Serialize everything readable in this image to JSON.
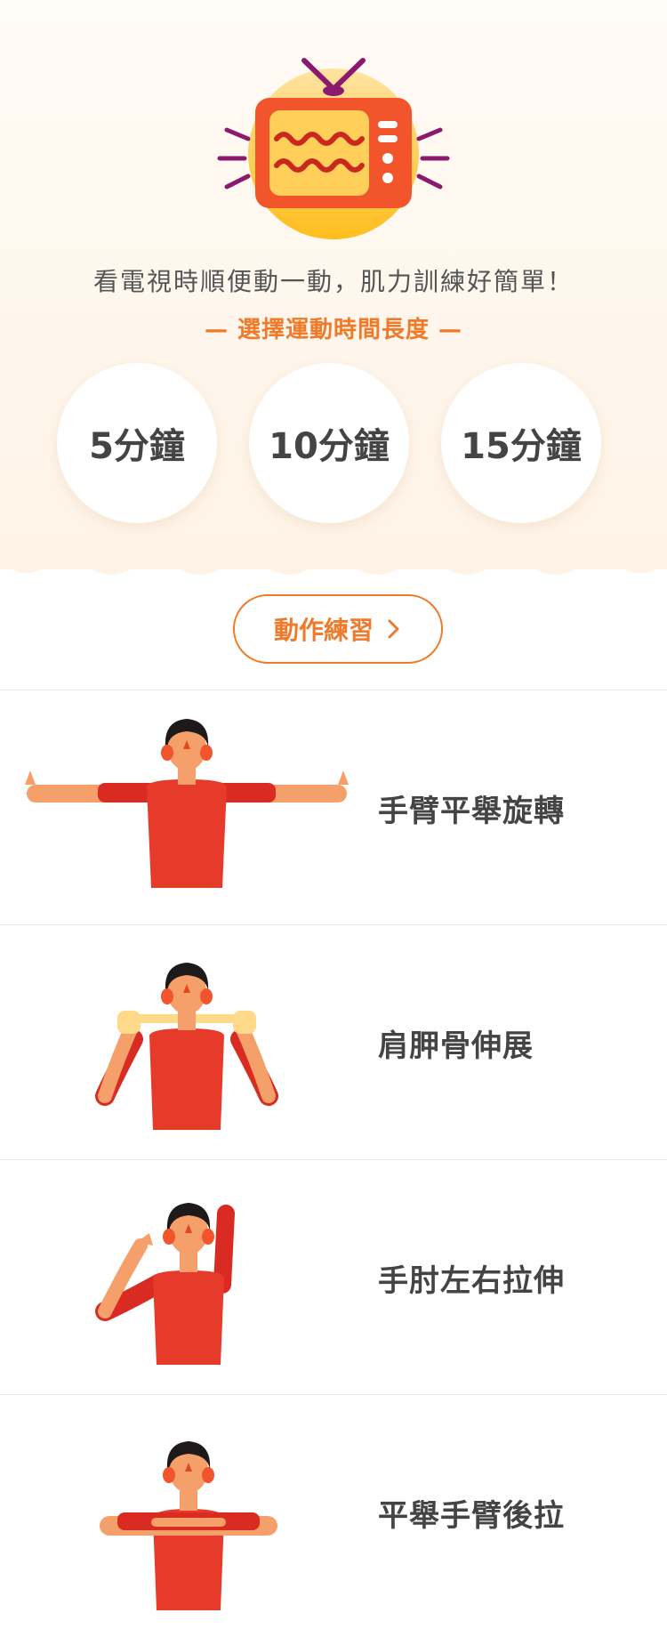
{
  "header": {
    "illustration": "retro-tv-illustration",
    "tagline": "看電視時順便動一動，肌力訓練好簡單！",
    "subtitle": "— 選擇運動時間長度 —"
  },
  "durations": [
    {
      "label": "5分鐘"
    },
    {
      "label": "10分鐘"
    },
    {
      "label": "15分鐘"
    }
  ],
  "practice_button": {
    "label": "動作練習",
    "icon": "chevron-right-icon"
  },
  "exercises": [
    {
      "label": "手臂平舉旋轉",
      "illustration": "arms-out-raised-illustration"
    },
    {
      "label": "肩胛骨伸展",
      "illustration": "shoulder-blade-stretch-illustration"
    },
    {
      "label": "手肘左右拉伸",
      "illustration": "elbow-stretch-illustration"
    },
    {
      "label": "平舉手臂後拉",
      "illustration": "arms-forward-pull-illustration"
    }
  ],
  "colors": {
    "accent": "#ef7a2a",
    "shirt": "#e63a2a",
    "skin": "#f5a06a",
    "tv_circle": "#ffc93a",
    "tv_body": "#f2552c",
    "antenna": "#8b1a6e"
  }
}
